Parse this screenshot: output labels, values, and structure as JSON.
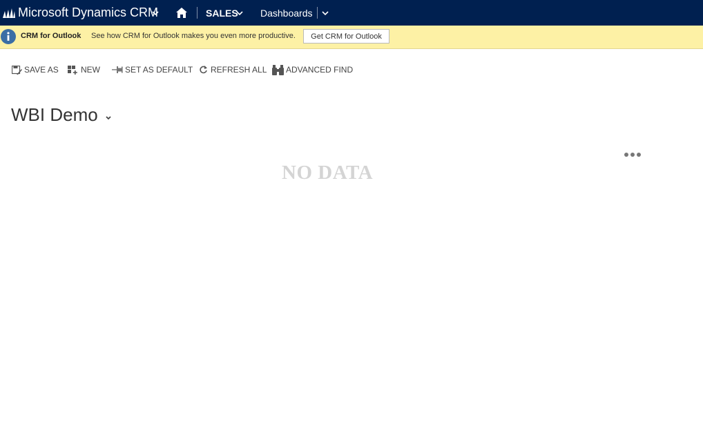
{
  "navbar": {
    "app_title": "Microsoft Dynamics CRM",
    "area_label": "SALES",
    "dashboards_label": "Dashboards",
    "logo_icon": "dynamics-logo-icon",
    "home_icon": "home-icon",
    "background_color": "#002050"
  },
  "notification": {
    "title": "CRM for Outlook",
    "message": "See how CRM for Outlook makes you even more productive.",
    "button_label": "Get CRM for Outlook",
    "icon": "info-icon",
    "background_color": "#fdf1a5"
  },
  "commands": {
    "save_as": "SAVE AS",
    "new": "NEW",
    "set_as_default": "SET AS DEFAULT",
    "refresh_all": "REFRESH ALL",
    "advanced_find": "ADVANCED FIND"
  },
  "dashboard": {
    "title": "WBI Demo",
    "empty_message": "NO DATA"
  }
}
